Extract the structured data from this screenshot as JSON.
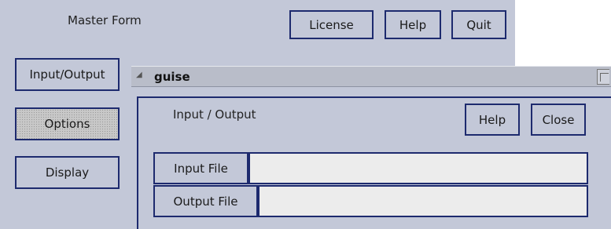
{
  "master": {
    "title": "Master Form",
    "buttons": {
      "license": "License",
      "help": "Help",
      "quit": "Quit"
    },
    "side_buttons": {
      "input_output": "Input/Output",
      "options": "Options",
      "display": "Display"
    }
  },
  "guise": {
    "title": "guise",
    "panel_title": "Input / Output",
    "buttons": {
      "help": "Help",
      "close": "Close"
    },
    "fields": {
      "input_label": "Input File",
      "input_value": "",
      "output_label": "Output File",
      "output_value": ""
    }
  }
}
